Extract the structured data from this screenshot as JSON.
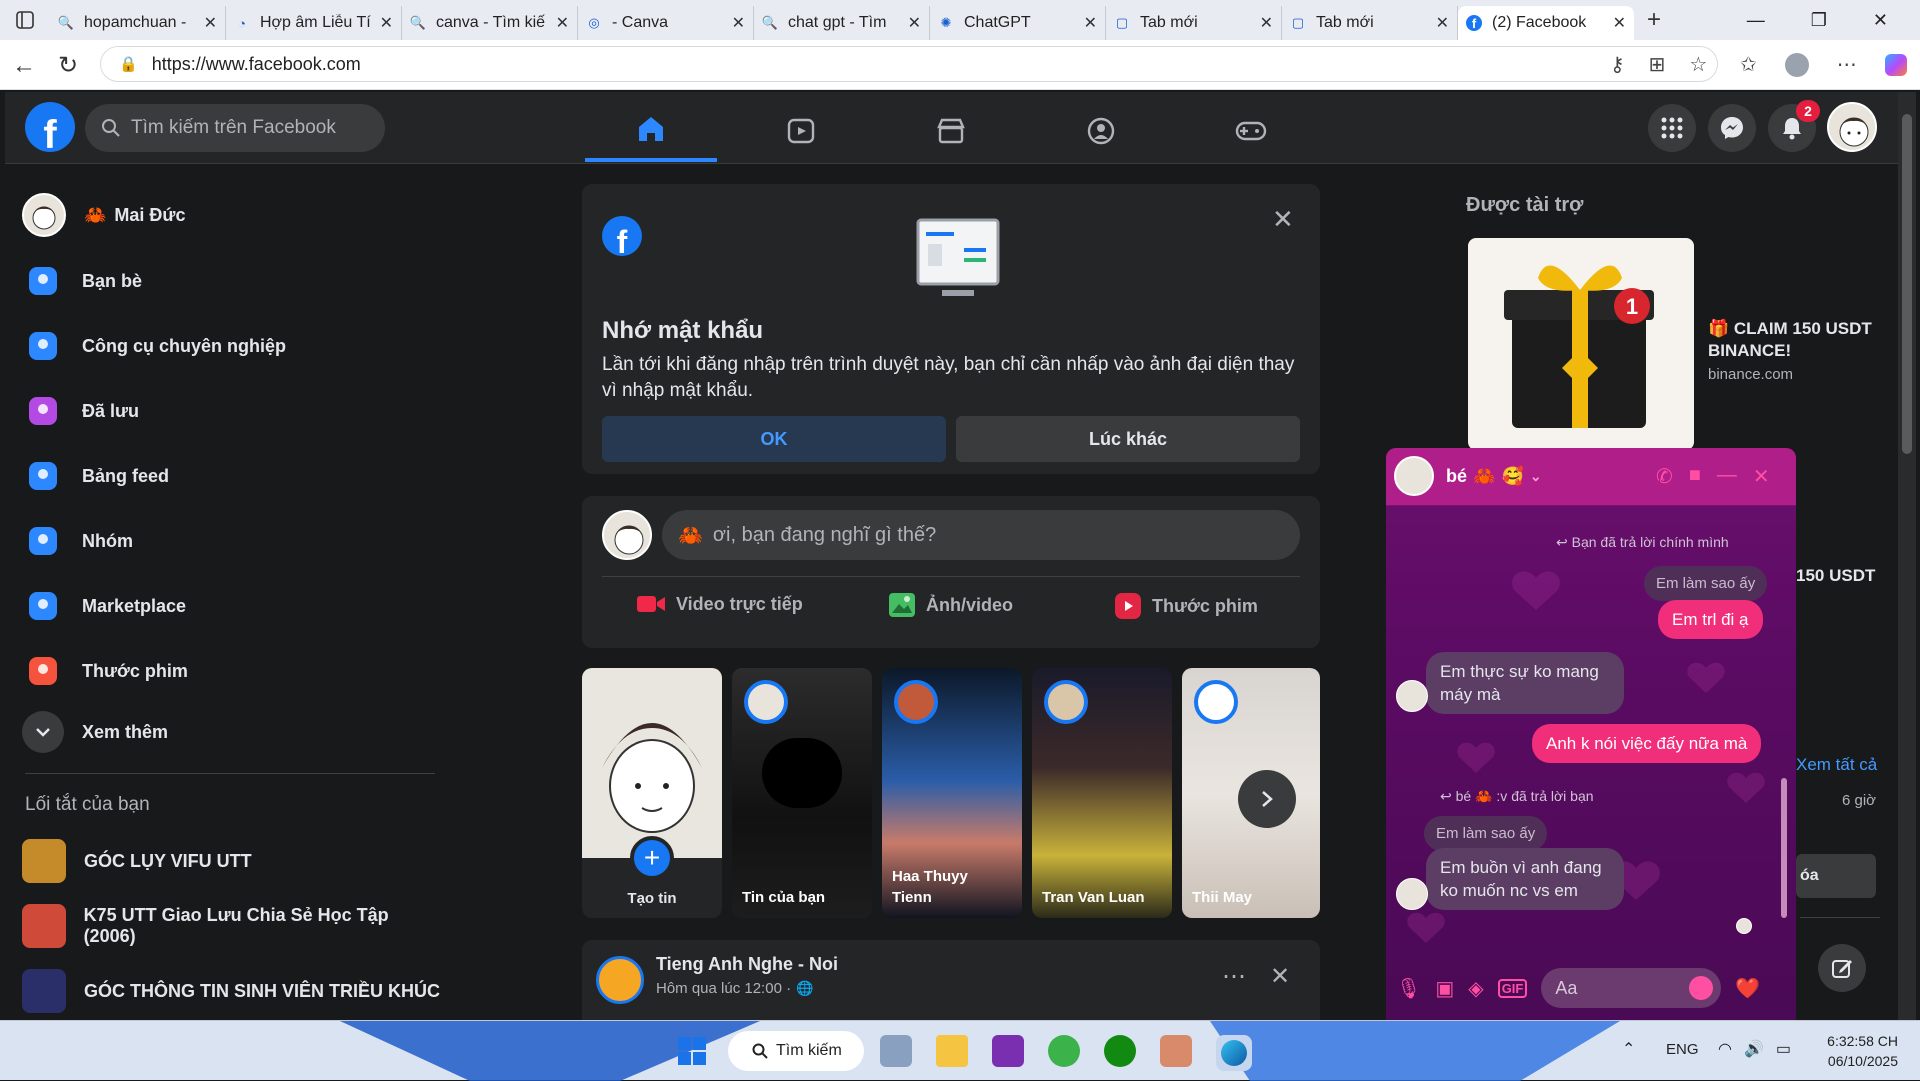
{
  "browser": {
    "tabs": [
      {
        "title": "hopamchuan -",
        "icon": "search-icon"
      },
      {
        "title": "Hợp âm Liễu Tí",
        "icon": "page-icon"
      },
      {
        "title": "canva - Tìm kiế",
        "icon": "search-icon"
      },
      {
        "title": "- Canva",
        "icon": "canva-icon"
      },
      {
        "title": "chat gpt - Tìm",
        "icon": "search-icon"
      },
      {
        "title": "ChatGPT",
        "icon": "chatgpt-icon"
      },
      {
        "title": "Tab mới",
        "icon": "newtab-icon"
      },
      {
        "title": "Tab mới",
        "icon": "newtab-icon"
      },
      {
        "title": "(2) Facebook",
        "icon": "facebook-icon"
      }
    ],
    "url": "https://www.facebook.com"
  },
  "fb": {
    "search_placeholder": "Tìm kiếm trên Facebook",
    "notification_count": "2",
    "user_name": "Mai Đức",
    "sidebar": [
      {
        "label": "Bạn bè",
        "icon": "friends-icon",
        "color": "#2d88ff"
      },
      {
        "label": "Công cụ chuyên nghiệp",
        "icon": "pro-tools-icon",
        "color": "#2d88ff"
      },
      {
        "label": "Đã lưu",
        "icon": "saved-icon",
        "color": "#b44ae4"
      },
      {
        "label": "Bảng feed",
        "icon": "feed-icon",
        "color": "#2d88ff"
      },
      {
        "label": "Nhóm",
        "icon": "groups-icon",
        "color": "#2d88ff"
      },
      {
        "label": "Marketplace",
        "icon": "marketplace-icon",
        "color": "#2d88ff"
      },
      {
        "label": "Thước phim",
        "icon": "reels-icon",
        "color": "#f5533d"
      }
    ],
    "see_more": "Xem thêm",
    "shortcuts_title": "Lối tắt của bạn",
    "shortcuts": [
      {
        "label": "GÓC LỤY VIFU UTT"
      },
      {
        "label": "K75 UTT Giao Lưu Chia Sẻ Học Tập (2006)"
      },
      {
        "label": "GÓC THÔNG TIN SINH VIÊN TRIỀU KHÚC"
      }
    ],
    "remember_password": {
      "title": "Nhớ mật khẩu",
      "body": "Lần tới khi đăng nhập trên trình duyệt này, bạn chỉ cần nhấp vào ảnh đại diện thay vì nhập mật khẩu.",
      "ok": "OK",
      "later": "Lúc khác"
    },
    "composer": {
      "placeholder": "ơi, bạn đang nghĩ gì thế?",
      "live": "Video trực tiếp",
      "photo": "Ảnh/video",
      "reel": "Thước phim"
    },
    "stories": [
      {
        "name": "Tạo tin"
      },
      {
        "name": "Tin của bạn"
      },
      {
        "name": "Haa Thuyy Tienn"
      },
      {
        "name": "Tran Van Luan"
      },
      {
        "name": "Thii May"
      }
    ],
    "post": {
      "page_name": "Tieng Anh Nghe - Noi",
      "time": "Hôm qua lúc 12:00 ·"
    },
    "sponsored": {
      "title": "Được tài trợ",
      "ad_title": "🎁 CLAIM 150 USDT BINANCE!",
      "ad_domain": "binance.com",
      "ad_title_2": "150 USDT",
      "see_all": "Xem tất cả",
      "time": "6 giờ",
      "partial_btn": "óa"
    }
  },
  "chat": {
    "name": "bé",
    "messages": {
      "reply_note_1": "Bạn đã trả lời chính mình",
      "quote_1": "Em làm sao ấy",
      "out_1": "Em trl đi ạ",
      "in_1": "Em thực sự ko mang máy mà",
      "out_2": "Anh k nói việc đấy nữa mà",
      "reply_note_2": "bé 🦀 :v đã trả lời bạn",
      "quote_2": "Em làm sao ấy",
      "in_2": "Em buồn vì anh đang ko muốn nc vs em"
    },
    "input_placeholder": "Aa"
  },
  "taskbar": {
    "search": "Tìm kiếm",
    "lang": "ENG",
    "time": "6:32:58 CH",
    "date": "06/10/2025"
  }
}
